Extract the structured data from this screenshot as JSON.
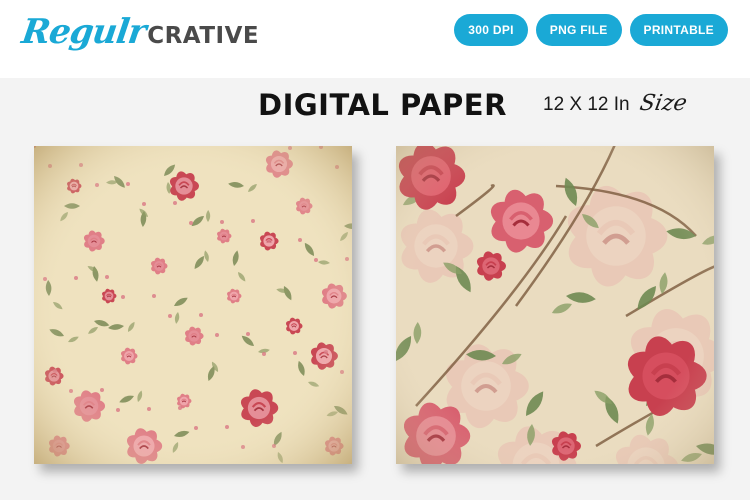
{
  "brand": {
    "script": "Regulr",
    "caps": "CRATIVE"
  },
  "badges": [
    "300 DPI",
    "PNG FILE",
    "PRINTABLE"
  ],
  "title": "DIGITAL PAPER",
  "size": {
    "dimensions": "12 X 12 In",
    "word": "Size"
  },
  "colors": {
    "accent": "#1aa9d6",
    "paper_left_bg": "#efe2bf",
    "paper_right_bg": "#eadcc0",
    "rose_pink": "#e07a85",
    "rose_red": "#c8404f",
    "leaf": "#7a8a55"
  },
  "papers": [
    {
      "name": "small-rose-pattern",
      "style": "repeating small pink roses on aged cream paper"
    },
    {
      "name": "large-rose-pattern",
      "style": "large red climbing roses with faded background roses"
    }
  ]
}
